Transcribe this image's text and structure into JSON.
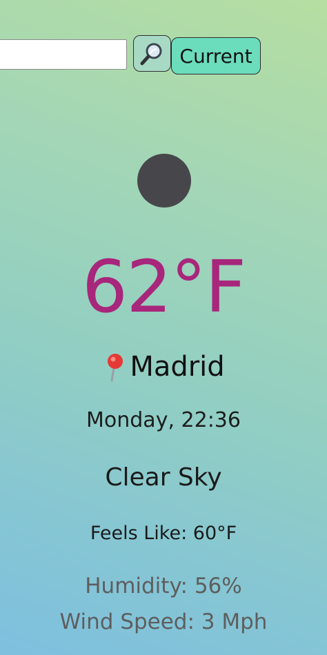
{
  "search": {
    "value": "",
    "placeholder": "",
    "button_icon": "search-icon",
    "current_label": "Current"
  },
  "weather": {
    "icon": "clear-sky-night-icon",
    "temperature": "62°F",
    "location_icon": "pin-icon",
    "city": "Madrid",
    "date_time": "Monday, 22:36",
    "condition": "Clear Sky",
    "feels_like": "Feels Like: 60°F",
    "humidity": "Humidity: 56%",
    "wind_speed": "Wind Speed: 3 Mph"
  },
  "colors": {
    "temperature": "#a8267b",
    "current_button": "#6bdcbc",
    "search_button": "#a8d9c4",
    "weather_icon": "#47474b",
    "secondary_text": "#5e5e5e"
  }
}
